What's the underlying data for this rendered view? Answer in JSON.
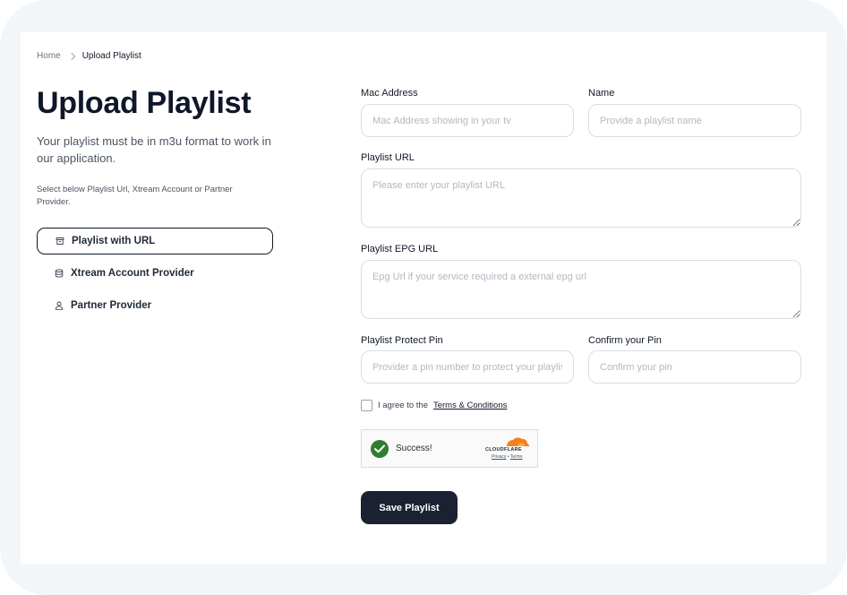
{
  "breadcrumb": {
    "home": "Home",
    "current": "Upload Playlist"
  },
  "page": {
    "title": "Upload Playlist",
    "subtitle": "Your playlist must be in m3u format to work in our application.",
    "helper": "Select below Playlist Url, Xtream Account or Partner Provider."
  },
  "sources": [
    {
      "label": "Playlist with URL",
      "icon": "archive-icon",
      "active": true
    },
    {
      "label": "Xtream Account Provider",
      "icon": "database-icon",
      "active": false
    },
    {
      "label": "Partner Provider",
      "icon": "user-icon",
      "active": false
    }
  ],
  "form": {
    "mac_label": "Mac Address",
    "mac_placeholder": "Mac Address showing in your tv",
    "name_label": "Name",
    "name_placeholder": "Provide a playlist name",
    "url_label": "Playlist URL",
    "url_placeholder": "Please enter your playlist URL",
    "epg_label": "Playlist EPG URL",
    "epg_placeholder": "Epg Url if your service required a external epg url",
    "pin_label": "Playlist Protect Pin",
    "pin_placeholder": "Provider a pin number to protect your playlist",
    "confirm_label": "Confirm your Pin",
    "confirm_placeholder": "Confirm your pin",
    "agree_text": "I agree to the",
    "terms_link": "Terms & Conditions",
    "save_label": "Save Playlist"
  },
  "captcha": {
    "status": "Success!",
    "brand": "CLOUDFLARE",
    "privacy": "Privacy",
    "separator": "•",
    "terms": "Terms"
  },
  "colors": {
    "frame": "#f3f6f9",
    "primary_button": "#1b2033",
    "success": "#2e7d32",
    "cloudflare": "#f38020"
  }
}
